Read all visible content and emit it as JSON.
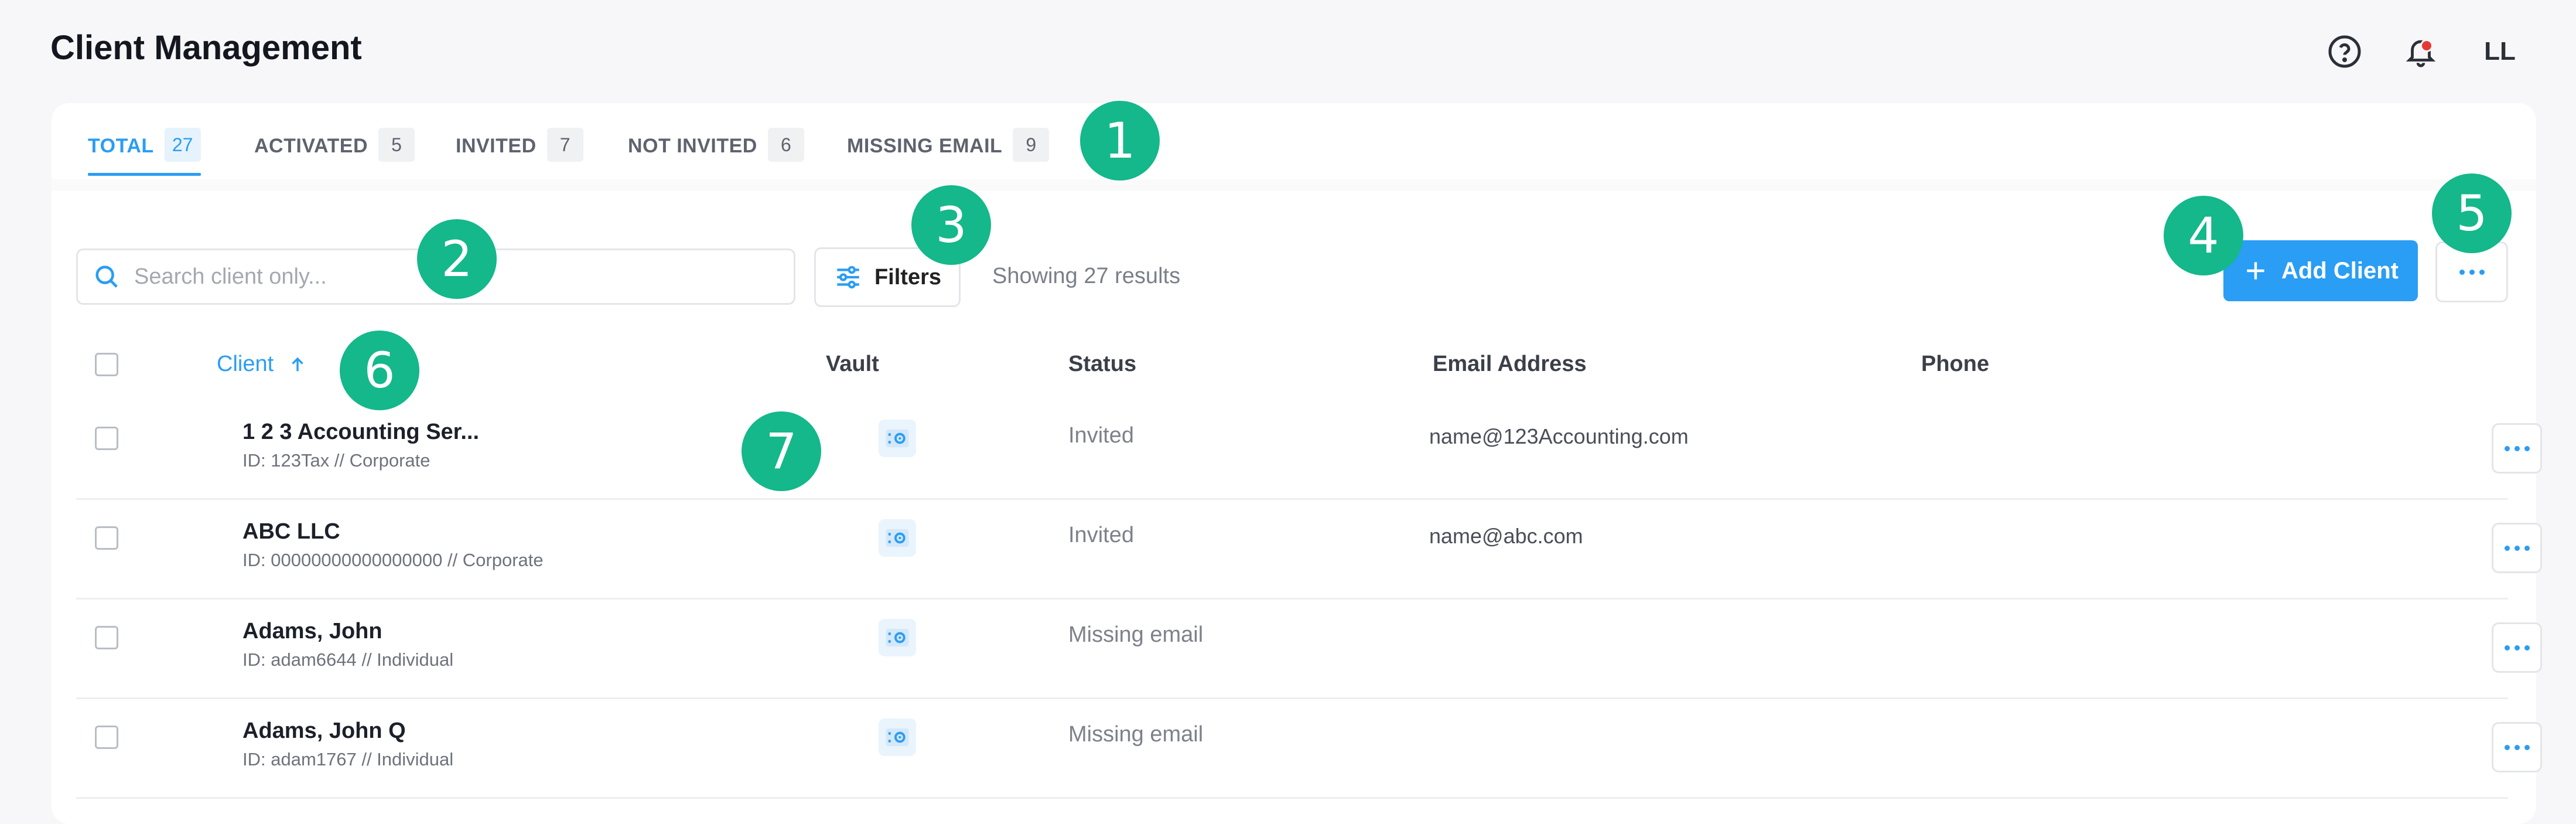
{
  "header": {
    "title": "Client Management",
    "icons": {
      "help": "help-circle-icon",
      "notifications": "bell-icon"
    },
    "avatar_initials": "LL"
  },
  "tabs": [
    {
      "label": "TOTAL",
      "count": "27",
      "active": true
    },
    {
      "label": "ACTIVATED",
      "count": "5",
      "active": false
    },
    {
      "label": "INVITED",
      "count": "7",
      "active": false
    },
    {
      "label": "NOT INVITED",
      "count": "6",
      "active": false
    },
    {
      "label": "MISSING EMAIL",
      "count": "9",
      "active": false
    }
  ],
  "toolbar": {
    "search_placeholder": "Search client only...",
    "filters_label": "Filters",
    "results_text": "Showing 27 results",
    "add_label": "Add Client"
  },
  "table": {
    "columns": {
      "client": "Client",
      "vault": "Vault",
      "status": "Status",
      "email": "Email Address",
      "phone": "Phone"
    },
    "sorted_column": "client",
    "sort_direction": "ascending",
    "rows": [
      {
        "name": "1 2 3 Accounting Ser...",
        "sub": "ID: 123Tax // Corporate",
        "status": "Invited",
        "email": "name@123Accounting.com",
        "phone": ""
      },
      {
        "name": "ABC LLC",
        "sub": "ID: 00000000000000000 // Corporate",
        "status": "Invited",
        "email": "name@abc.com",
        "phone": ""
      },
      {
        "name": "Adams, John",
        "sub": "ID: adam6644 // Individual",
        "status": "Missing email",
        "email": "",
        "phone": ""
      },
      {
        "name": "Adams, John Q",
        "sub": "ID: adam1767 // Individual",
        "status": "Missing email",
        "email": "",
        "phone": ""
      }
    ]
  },
  "annotations": [
    "1",
    "2",
    "3",
    "4",
    "5",
    "6",
    "7"
  ],
  "colors": {
    "accent": "#2a9df4",
    "badge": "#14b88a",
    "notification_dot": "#e53935"
  }
}
